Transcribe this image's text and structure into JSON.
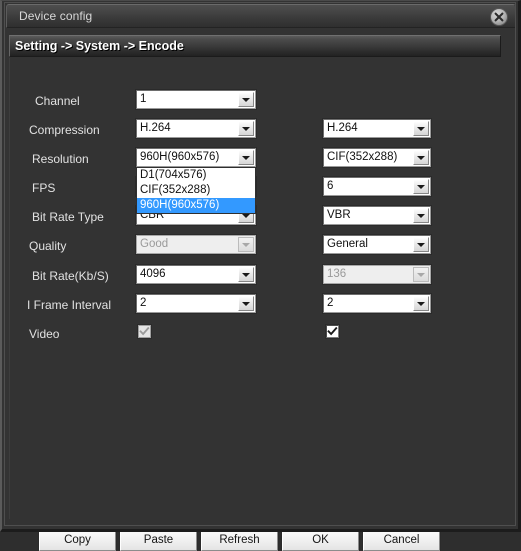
{
  "window": {
    "title": "Device config",
    "close_icon": "close-circle-icon"
  },
  "section": {
    "breadcrumb": "Setting -> System -> Encode"
  },
  "colors": {
    "window_bg": "#333333",
    "titlebar_gradient_top": "#4e4e4e",
    "label_text": "#e2e2e2",
    "field_bg": "#ffffff",
    "field_text": "#111111",
    "disabled_text": "#9a9a9a",
    "highlight_blue": "#3399ff",
    "button_face": "#f0f0f0"
  },
  "form": {
    "rows": [
      {
        "label": "Channel",
        "main_value": "1",
        "main_disabled": false,
        "sub_value": null,
        "sub_disabled": false
      },
      {
        "label": "Compression",
        "main_value": "H.264",
        "main_disabled": false,
        "sub_value": "H.264",
        "sub_disabled": false
      },
      {
        "label": "Resolution",
        "main_value": "960H(960x576)",
        "main_disabled": false,
        "sub_value": "CIF(352x288)",
        "sub_disabled": false
      },
      {
        "label": "FPS",
        "main_value": "",
        "main_disabled": false,
        "sub_value": "6",
        "sub_disabled": false
      },
      {
        "label": "Bit Rate Type",
        "main_value": "CBR",
        "main_disabled": false,
        "sub_value": "VBR",
        "sub_disabled": false
      },
      {
        "label": "Quality",
        "main_value": "Good",
        "main_disabled": true,
        "sub_value": "General",
        "sub_disabled": false
      },
      {
        "label": "Bit Rate(Kb/S)",
        "main_value": "4096",
        "main_disabled": false,
        "sub_value": "136",
        "sub_disabled": true
      },
      {
        "label": "I Frame Interval",
        "main_value": "2",
        "main_disabled": false,
        "sub_value": "2",
        "sub_disabled": false
      },
      {
        "label": "Video",
        "main_value": null,
        "main_disabled": true,
        "sub_value": null,
        "sub_disabled": false
      }
    ]
  },
  "resolution_dropdown": {
    "open": true,
    "options": [
      "D1(704x576)",
      "CIF(352x288)",
      "960H(960x576)"
    ],
    "selected": "960H(960x576)",
    "selected_index": 2
  },
  "video_checkboxes": {
    "main_checked": true,
    "main_enabled": false,
    "sub_checked": true,
    "sub_enabled": true
  },
  "buttons": [
    {
      "label": "Copy"
    },
    {
      "label": "Paste"
    },
    {
      "label": "Refresh"
    },
    {
      "label": "OK"
    },
    {
      "label": "Cancel"
    }
  ]
}
